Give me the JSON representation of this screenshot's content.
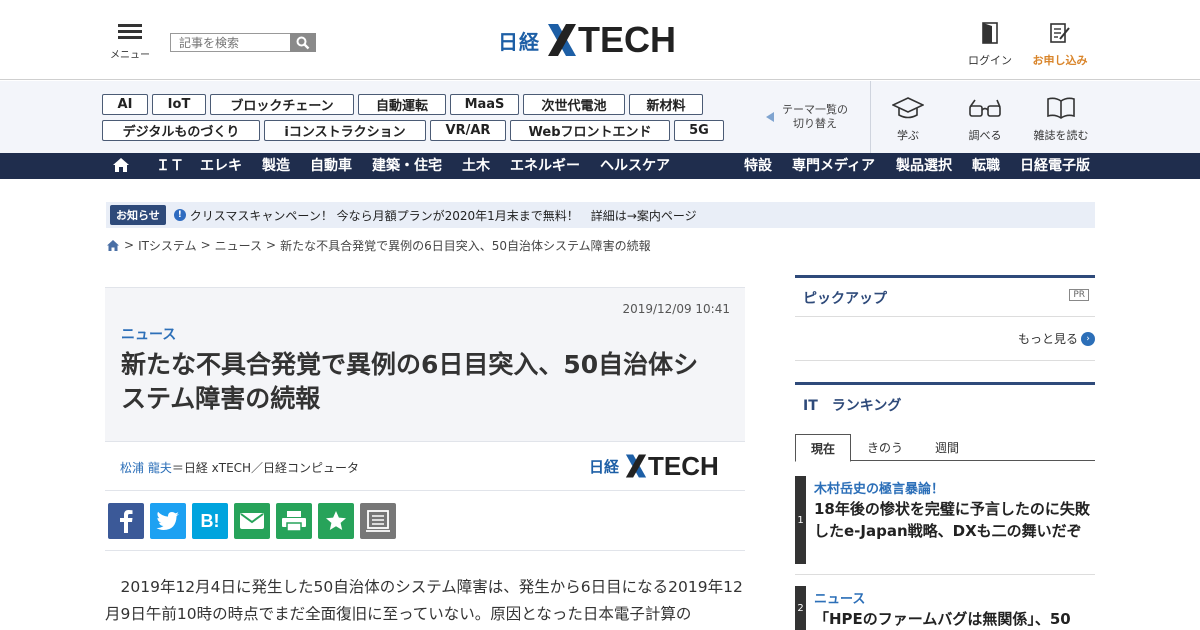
{
  "header": {
    "menu_label": "メニュー",
    "search_placeholder": "記事を検索",
    "logo_nikkei": "日経",
    "logo_xtech_rest": "TECH",
    "login_label": "ログイン",
    "apply_label": "お申し込み"
  },
  "themes": {
    "tags": [
      "AI",
      "IoT",
      "ブロックチェーン",
      "自動運転",
      "MaaS",
      "次世代電池",
      "新材料",
      "デジタルものづくり",
      "iコンストラクション",
      "VR/AR",
      "Webフロントエンド",
      "5G"
    ],
    "switch_line1": "テーマ一覧の",
    "switch_line2": "切り替え",
    "quick": [
      "学ぶ",
      "調べる",
      "雑誌を読む"
    ]
  },
  "nav": {
    "left": [
      "ＩＴ",
      "エレキ",
      "製造",
      "自動車",
      "建築・住宅",
      "土木",
      "エネルギー",
      "ヘルスケア"
    ],
    "right": [
      "特設",
      "専門メディア",
      "製品選択",
      "転職",
      "日経電子版"
    ]
  },
  "notice": {
    "badge": "お知らせ",
    "text": "クリスマスキャンペーン！ 今なら月額プランが2020年1月末まで無料！　詳細は→案内ページ"
  },
  "breadcrumb": [
    "ITシステム",
    "ニュース",
    "新たな不具合発覚で異例の6日目突入、50自治体システム障害の続報"
  ],
  "article": {
    "date": "2019/12/09 10:41",
    "category": "ニュース",
    "title": "新たな不具合発覚で異例の6日目突入、50自治体システム障害の続報",
    "author_name": "松浦 龍夫",
    "author_affil": "＝日経 xTECH／日経コンピュータ",
    "body": "2019年12月4日に発生した50自治体のシステム障害は、発生から6日目になる2019年12月9日午前10時の時点でまだ全面復旧に至っていない。原因となった日本電子計算の"
  },
  "sidebar": {
    "pickup_title": "ピックアップ",
    "pr_label": "PR",
    "more_label": "もっと見る",
    "ranking_title": "IT　ランキング",
    "tabs": [
      "現在",
      "きのう",
      "週間"
    ],
    "ranking": [
      {
        "num": "1",
        "category": "木村岳史の極言暴論！",
        "title": "18年後の惨状を完璧に予言したのに失敗したe-Japan戦略、DXも二の舞いだぞ"
      },
      {
        "num": "2",
        "category": "ニュース",
        "title": "「HPEのファームバグは無関係」、50"
      }
    ]
  },
  "colors": {
    "navy": "#1f2d4d",
    "accent_blue": "#2c6fb8",
    "apply_orange": "#d9852b",
    "facebook": "#3b5998",
    "twitter": "#1da1f2",
    "hatena": "#00a4de",
    "mail": "#27a35a",
    "print": "#27a35a",
    "bookmark": "#27a35a",
    "memo": "#777777"
  }
}
